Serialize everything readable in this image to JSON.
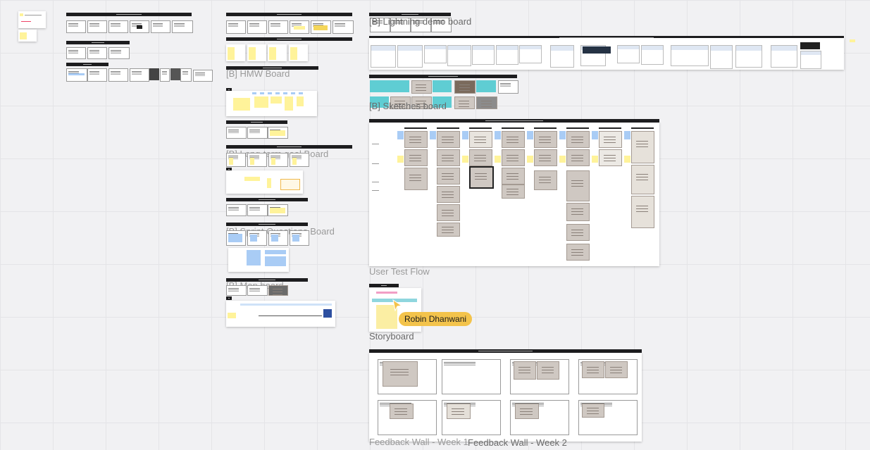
{
  "canvas": {
    "boards": {
      "lightning_demo": "[B] Lightning demo board",
      "hmw": "[B] HMW Board",
      "sketches": "[B] Sketches board",
      "long_term_goal": "[B] Long-term goal Board",
      "sprint_questions": "[B] Sprint Questions Board",
      "map": "[B] Map board",
      "user_test_flow": "User Test Flow",
      "storyboard": "Storyboard",
      "feedback_wall_1": "Feedback Wall - Week 1",
      "feedback_wall_2": "Feedback Wall - Week 2"
    },
    "collaborator": {
      "name": "Robin Dhanwani",
      "color": "#f3c34b"
    }
  }
}
